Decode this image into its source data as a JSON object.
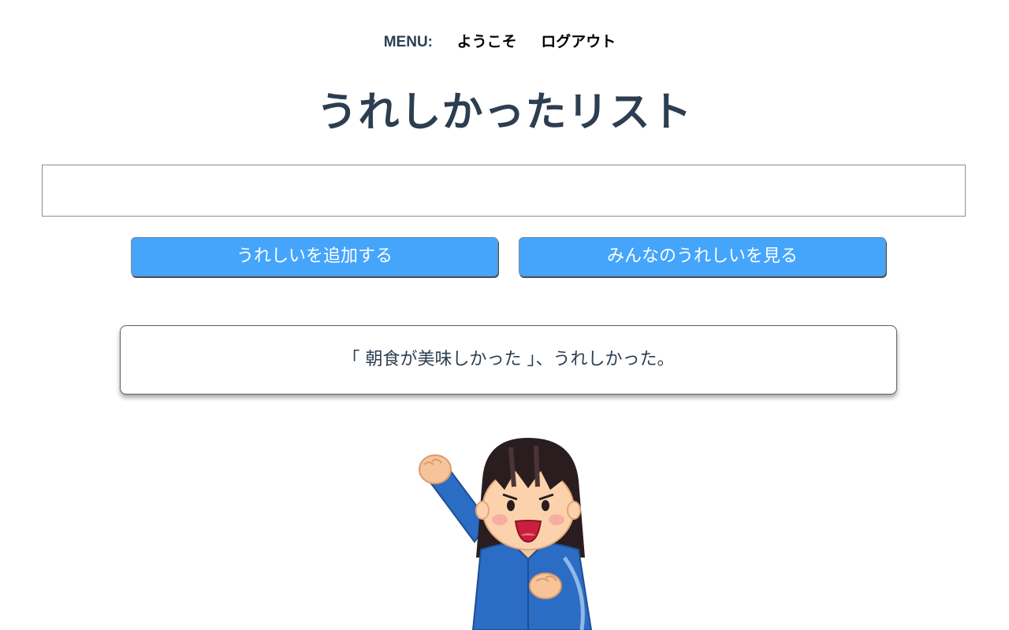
{
  "menu": {
    "label": "MENU:",
    "welcome": "ようこそ",
    "logout": "ログアウト"
  },
  "title": "うれしかったリスト",
  "input": {
    "value": "",
    "placeholder": ""
  },
  "buttons": {
    "add": "うれしいを追加する",
    "view_all": "みんなのうれしいを見る"
  },
  "message": "「 朝食が美味しかった 」、うれしかった。",
  "colors": {
    "title": "#2c3e50",
    "button": "#45a5fb",
    "illustration_jacket": "#2b6cc4"
  },
  "illustration": {
    "icon": "cheering-girl-illustration"
  }
}
